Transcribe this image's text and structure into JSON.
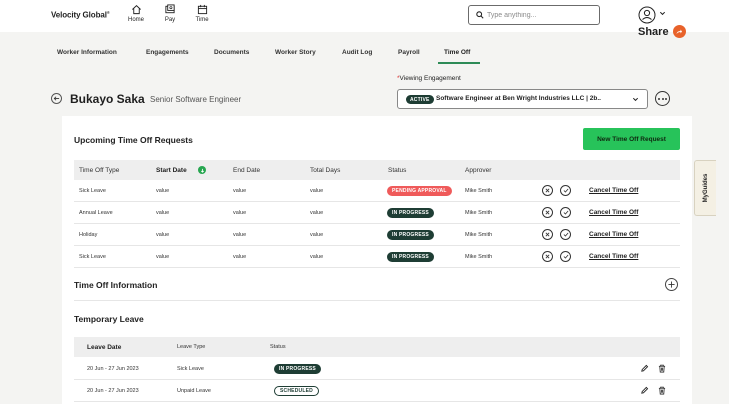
{
  "header": {
    "brand": "Velocity Global",
    "brand_mark": "®",
    "nav": [
      {
        "label": "Home",
        "icon": "home-icon"
      },
      {
        "label": "Pay",
        "icon": "pay-icon"
      },
      {
        "label": "Time",
        "icon": "calendar-icon"
      }
    ],
    "search_placeholder": "Type anything...",
    "share_label": "Share"
  },
  "tabs": [
    {
      "label": "Worker Information"
    },
    {
      "label": "Engagements"
    },
    {
      "label": "Documents"
    },
    {
      "label": "Worker Story"
    },
    {
      "label": "Audit Log"
    },
    {
      "label": "Payroll"
    },
    {
      "label": "Time Off",
      "active": true
    }
  ],
  "engagement": {
    "label": "Viewing Engagement",
    "required_mark": "*",
    "badge": "ACTIVE",
    "value": "Software Engineer at Ben Wright Industries LLC | 2b.."
  },
  "worker": {
    "name": "Bukayo Saka",
    "title": "Senior Software Engineer"
  },
  "time_off": {
    "title": "Upcoming Time Off Requests",
    "new_button": "New Time Off Request",
    "columns": [
      "Time Off Type",
      "Start Date",
      "End Date",
      "Total Days",
      "Status",
      "Approver"
    ],
    "rows": [
      {
        "type": "Sick Leave",
        "start": "value",
        "end": "value",
        "days": "value",
        "status": "PENDING APPROVAL",
        "status_kind": "pending",
        "approver": "Mike Smith",
        "action": "Cancel Time Off"
      },
      {
        "type": "Annual Leave",
        "start": "value",
        "end": "value",
        "days": "value",
        "status": "IN PROGRESS",
        "status_kind": "progress",
        "approver": "Mike Smith",
        "action": "Cancel Time Off"
      },
      {
        "type": "Holiday",
        "start": "value",
        "end": "value",
        "days": "value",
        "status": "IN PROGRESS",
        "status_kind": "progress",
        "approver": "Mike Smith",
        "action": "Cancel Time Off"
      },
      {
        "type": "Sick Leave",
        "start": "value",
        "end": "value",
        "days": "value",
        "status": "IN PROGRESS",
        "status_kind": "progress",
        "approver": "Mike Smith",
        "action": "Cancel Time Off"
      }
    ]
  },
  "time_off_info": {
    "title": "Time Off Information"
  },
  "temporary_leave": {
    "title": "Temporary Leave",
    "columns": [
      "Leave Date",
      "Leave Type",
      "Status"
    ],
    "rows": [
      {
        "date": "20 Jun - 27 Jun 2023",
        "type": "Sick Leave",
        "status": "IN PROGRESS",
        "status_kind": "progress"
      },
      {
        "date": "20 Jun - 27 Jun 2023",
        "type": "Unpaid Leave",
        "status": "SCHEDULED",
        "status_kind": "scheduled"
      }
    ]
  },
  "myguides": {
    "label": "MyGuides"
  },
  "colors": {
    "accent_green": "#27c35a",
    "badge_dark": "#1e3d34",
    "pending_red": "#ef5a5a",
    "share_orange": "#e8622a"
  }
}
